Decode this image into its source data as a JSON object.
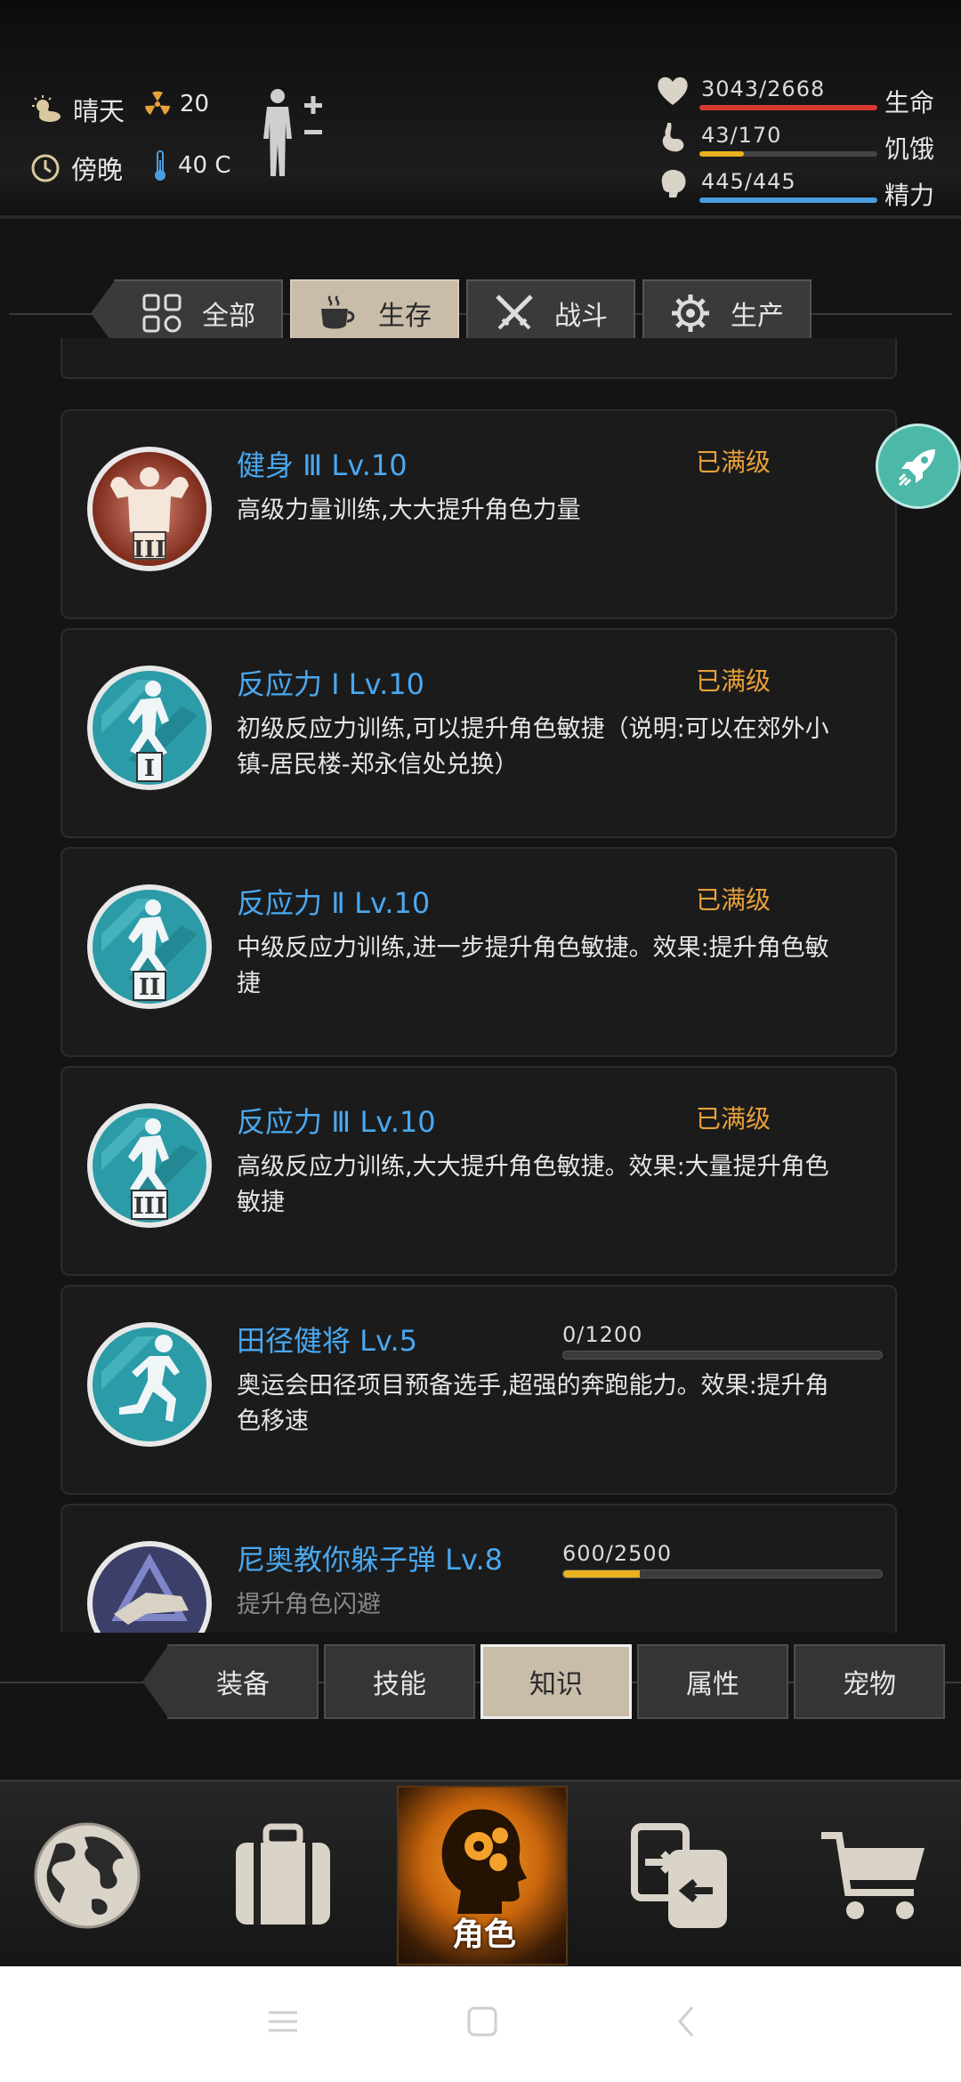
{
  "status": {
    "weather": "晴天",
    "time_of_day": "傍晚",
    "radiation": "20",
    "temperature": "40 C"
  },
  "vitals": [
    {
      "label": "生命",
      "value": "3043/2668",
      "fraction": 1.0,
      "color": "#d93a2f",
      "icon": "heart-icon"
    },
    {
      "label": "饥饿",
      "value": "43/170",
      "fraction": 0.25,
      "color": "#e8b21e",
      "icon": "stomach-icon"
    },
    {
      "label": "精力",
      "value": "445/445",
      "fraction": 1.0,
      "color": "#4a9ee0",
      "icon": "brain-icon"
    }
  ],
  "category_tabs": [
    {
      "label": "全部",
      "icon": "grid-icon",
      "active": false
    },
    {
      "label": "生存",
      "icon": "coffee-icon",
      "active": true
    },
    {
      "label": "战斗",
      "icon": "swords-icon",
      "active": false
    },
    {
      "label": "生产",
      "icon": "gear-icon",
      "active": false
    }
  ],
  "skills": [
    {
      "title": "健身 Ⅲ Lv.10",
      "status": "已满级",
      "desc": "高级力量训练,大大提升角色力量",
      "badge": "III",
      "badge_color": "#c0432a",
      "icon": "strength-icon"
    },
    {
      "title": "反应力 Ⅰ Lv.10",
      "status": "已满级",
      "desc": "初级反应力训练,可以提升角色敏捷（说明:可以在郊外小镇-居民楼-郑永信处兑换）",
      "badge": "I",
      "badge_color": "#2a9ba7",
      "icon": "agility-icon"
    },
    {
      "title": "反应力 Ⅱ Lv.10",
      "status": "已满级",
      "desc": "中级反应力训练,进一步提升角色敏捷。效果:提升角色敏捷",
      "badge": "II",
      "badge_color": "#2a9ba7",
      "icon": "agility-icon"
    },
    {
      "title": "反应力 Ⅲ Lv.10",
      "status": "已满级",
      "desc": "高级反应力训练,大大提升角色敏捷。效果:大量提升角色敏捷",
      "badge": "III",
      "badge_color": "#2a9ba7",
      "icon": "agility-icon"
    },
    {
      "title": "田径健将 Lv.5",
      "progress": "0/1200",
      "progress_fraction": 0.0,
      "desc": "奥运会田径项目预备选手,超强的奔跑能力。效果:提升角色移速",
      "badge": "",
      "badge_color": "#2a9ba7",
      "icon": "runner-icon"
    },
    {
      "title": "尼奥教你躲子弹 Lv.8",
      "progress": "600/2500",
      "progress_fraction": 0.24,
      "desc": "提升角色闪避",
      "badge": "",
      "badge_color": "#3c3f6a",
      "icon": "dodge-icon"
    }
  ],
  "sub_tabs": [
    {
      "label": "装备",
      "active": false
    },
    {
      "label": "技能",
      "active": false
    },
    {
      "label": "知识",
      "active": true
    },
    {
      "label": "属性",
      "active": false
    },
    {
      "label": "宠物",
      "active": false
    }
  ],
  "bottom_nav": {
    "role_label": "角色"
  }
}
